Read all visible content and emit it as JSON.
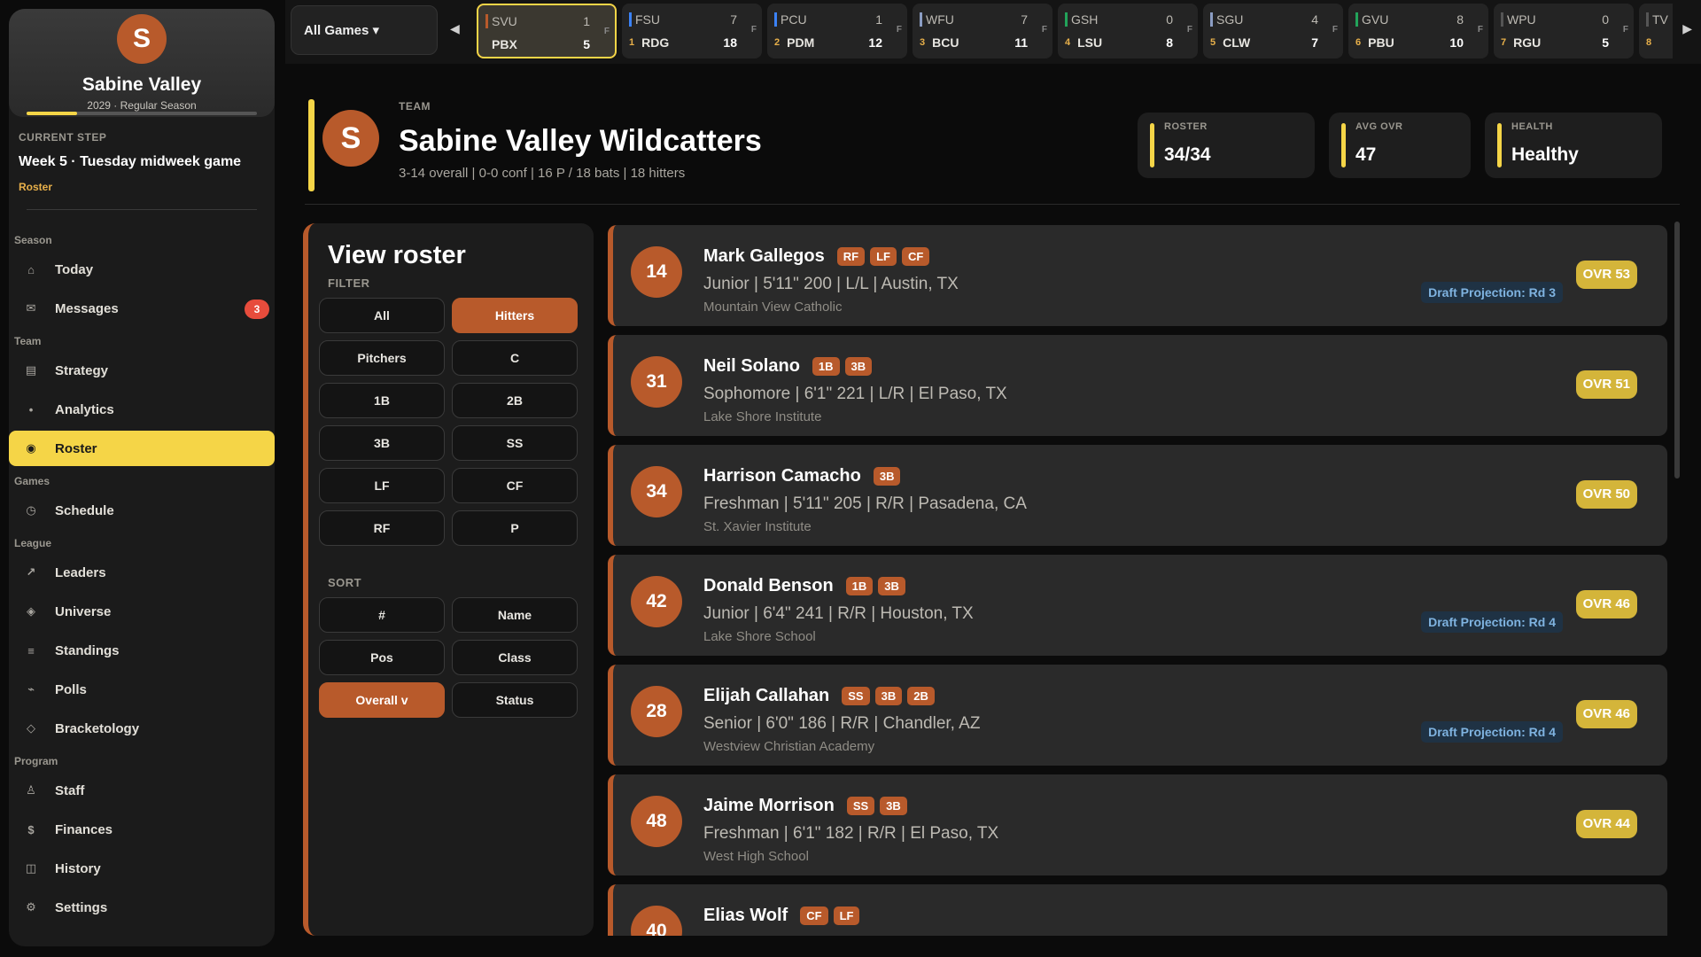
{
  "sidebar": {
    "logo_letter": "S",
    "team_name": "Sabine Valley",
    "season_line": "2029 · Regular Season",
    "season_progress": 0.22,
    "current_step_label": "CURRENT STEP",
    "current_step": "Week 5 · Tuesday midweek game",
    "current_step_link": "Roster",
    "groups": [
      {
        "label": "Season",
        "items": [
          {
            "label": "Today",
            "icon": "⌂",
            "name": "home-icon"
          },
          {
            "label": "Messages",
            "icon": "✉",
            "name": "mail-icon",
            "badge": "3"
          }
        ]
      },
      {
        "label": "Team",
        "items": [
          {
            "label": "Strategy",
            "icon": "▤",
            "name": "strategy-icon"
          },
          {
            "label": "Analytics",
            "icon": "•",
            "name": "analytics-icon"
          },
          {
            "label": "Roster",
            "icon": "◉",
            "name": "roster-icon",
            "active": true
          }
        ]
      },
      {
        "label": "Games",
        "items": [
          {
            "label": "Schedule",
            "icon": "◷",
            "name": "clock-icon"
          }
        ]
      },
      {
        "label": "League",
        "items": [
          {
            "label": "Leaders",
            "icon": "↗",
            "name": "trend-up-icon"
          },
          {
            "label": "Universe",
            "icon": "◈",
            "name": "universe-icon"
          },
          {
            "label": "Standings",
            "icon": "≡",
            "name": "list-icon"
          },
          {
            "label": "Polls",
            "icon": "⌁",
            "name": "polls-icon"
          },
          {
            "label": "Bracketology",
            "icon": "◇",
            "name": "diamond-icon"
          }
        ]
      },
      {
        "label": "Program",
        "items": [
          {
            "label": "Staff",
            "icon": "♙",
            "name": "staff-icon"
          },
          {
            "label": "Finances",
            "icon": "$",
            "name": "dollar-icon"
          },
          {
            "label": "History",
            "icon": "◫",
            "name": "history-icon"
          },
          {
            "label": "Settings",
            "icon": "⚙",
            "name": "gear-icon"
          }
        ]
      }
    ]
  },
  "scores": {
    "filter_label": "All Games ▾",
    "games": [
      {
        "away": "SVU",
        "away_score": "1",
        "away_color": "#b85a2b",
        "home": "PBX",
        "home_score": "5",
        "home_seed": "",
        "home_color": "#f5d547",
        "status": "F",
        "selected": true
      },
      {
        "away": "FSU",
        "away_score": "7",
        "away_color": "#3b82f6",
        "home": "RDG",
        "home_score": "18",
        "home_seed": "1",
        "home_color": "#e8b04a",
        "status": "F"
      },
      {
        "away": "PCU",
        "away_score": "1",
        "away_color": "#3b82f6",
        "home": "PDM",
        "home_score": "12",
        "home_seed": "2",
        "home_color": "#e8b04a",
        "status": "F"
      },
      {
        "away": "WFU",
        "away_score": "7",
        "away_color": "#8b9dc3",
        "home": "BCU",
        "home_score": "11",
        "home_seed": "3",
        "home_color": "#e8b04a",
        "status": "F"
      },
      {
        "away": "GSH",
        "away_score": "0",
        "away_color": "#22a35a",
        "home": "LSU",
        "home_score": "8",
        "home_seed": "4",
        "home_color": "#e8b04a",
        "status": "F"
      },
      {
        "away": "SGU",
        "away_score": "4",
        "away_color": "#8b9dc3",
        "home": "CLW",
        "home_score": "7",
        "home_seed": "5",
        "home_color": "#e8b04a",
        "status": "F"
      },
      {
        "away": "GVU",
        "away_score": "8",
        "away_color": "#22a35a",
        "home": "PBU",
        "home_score": "10",
        "home_seed": "6",
        "home_color": "#e8b04a",
        "status": "F"
      },
      {
        "away": "WPU",
        "away_score": "0",
        "away_color": "#555555",
        "home": "RGU",
        "home_score": "5",
        "home_seed": "7",
        "home_color": "#e8b04a",
        "status": "F"
      },
      {
        "away": "TV",
        "away_score": "",
        "away_color": "#555555",
        "home": "",
        "home_score": "",
        "home_seed": "8",
        "home_color": "#e8b04a",
        "status": ""
      }
    ]
  },
  "team": {
    "label": "TEAM",
    "logo_letter": "S",
    "name": "Sabine Valley Wildcatters",
    "summary": "3-14 overall | 0-0 conf | 16 P / 18 bats | 18 hitters",
    "stats": [
      {
        "label": "ROSTER",
        "value": "34/34"
      },
      {
        "label": "AVG OVR",
        "value": "47"
      },
      {
        "label": "HEALTH",
        "value": "Healthy"
      }
    ]
  },
  "filter_panel": {
    "title": "View roster",
    "filter_label": "FILTER",
    "filters": [
      {
        "label": "All"
      },
      {
        "label": "Hitters",
        "active": true
      },
      {
        "label": "Pitchers"
      },
      {
        "label": "C"
      },
      {
        "label": "1B"
      },
      {
        "label": "2B"
      },
      {
        "label": "3B"
      },
      {
        "label": "SS"
      },
      {
        "label": "LF"
      },
      {
        "label": "CF"
      },
      {
        "label": "RF"
      },
      {
        "label": "P"
      }
    ],
    "sort_label": "SORT",
    "sorts": [
      {
        "label": "#"
      },
      {
        "label": "Name"
      },
      {
        "label": "Pos"
      },
      {
        "label": "Class"
      },
      {
        "label": "Overall v",
        "active": true
      },
      {
        "label": "Status"
      }
    ]
  },
  "players": [
    {
      "number": "14",
      "name": "Mark Gallegos",
      "positions": [
        "RF",
        "LF",
        "CF"
      ],
      "info": "Junior  |  5'11\" 200  |  L/L  |  Austin, TX",
      "school": "Mountain View Catholic",
      "draft": "Draft Projection: Rd 3",
      "ovr": "OVR 53"
    },
    {
      "number": "31",
      "name": "Neil Solano",
      "positions": [
        "1B",
        "3B"
      ],
      "info": "Sophomore  |  6'1\" 221  |  L/R  |  El Paso, TX",
      "school": "Lake Shore Institute",
      "draft": "",
      "ovr": "OVR 51"
    },
    {
      "number": "34",
      "name": "Harrison Camacho",
      "positions": [
        "3B"
      ],
      "info": "Freshman  |  5'11\" 205  |  R/R  |  Pasadena, CA",
      "school": "St. Xavier Institute",
      "draft": "",
      "ovr": "OVR 50"
    },
    {
      "number": "42",
      "name": "Donald Benson",
      "positions": [
        "1B",
        "3B"
      ],
      "info": "Junior  |  6'4\" 241  |  R/R  |  Houston, TX",
      "school": "Lake Shore School",
      "draft": "Draft Projection: Rd 4",
      "ovr": "OVR 46"
    },
    {
      "number": "28",
      "name": "Elijah Callahan",
      "positions": [
        "SS",
        "3B",
        "2B"
      ],
      "info": "Senior  |  6'0\" 186  |  R/R  |  Chandler, AZ",
      "school": "Westview Christian Academy",
      "draft": "Draft Projection: Rd 4",
      "ovr": "OVR 46"
    },
    {
      "number": "48",
      "name": "Jaime Morrison",
      "positions": [
        "SS",
        "3B"
      ],
      "info": "Freshman  |  6'1\" 182  |  R/R  |  El Paso, TX",
      "school": "West High School",
      "draft": "",
      "ovr": "OVR 44"
    },
    {
      "number": "40",
      "name": "Elias Wolf",
      "positions": [
        "CF",
        "LF"
      ],
      "info": "",
      "school": "",
      "draft": "",
      "ovr": ""
    }
  ]
}
